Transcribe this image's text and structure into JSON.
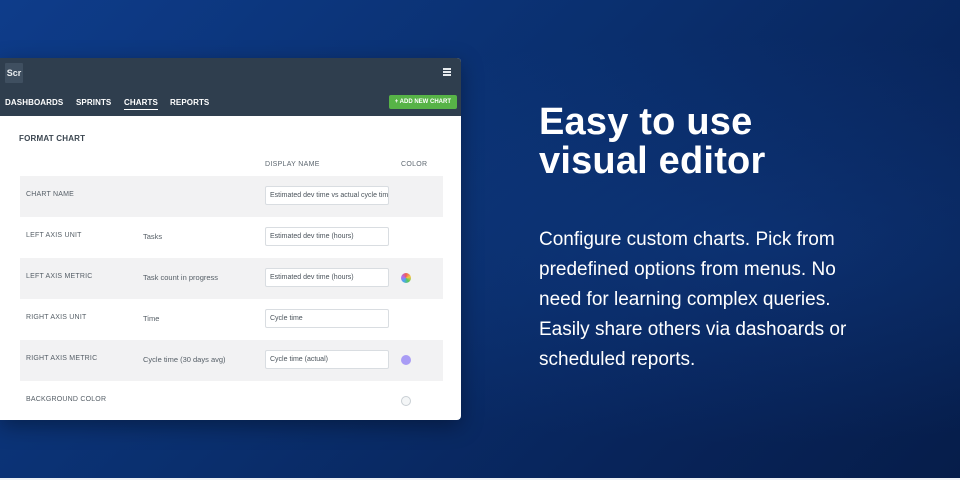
{
  "app": {
    "logo_text": "Scr",
    "nav": [
      "DASHBOARDS",
      "SPRINTS",
      "CHARTS",
      "REPORTS"
    ],
    "active_nav": "CHARTS",
    "add_button": "+ ADD NEW CHART"
  },
  "panel": {
    "title": "FORMAT CHART",
    "col_display_name": "DISPLAY NAME",
    "col_color": "COLOR",
    "rows": [
      {
        "label": "CHART NAME",
        "value": "",
        "field": "Estimated dev time vs actual cycle time",
        "color": ""
      },
      {
        "label": "LEFT AXIS UNIT",
        "value": "Tasks",
        "field": "Estimated dev time (hours)",
        "color": ""
      },
      {
        "label": "LEFT AXIS METRIC",
        "value": "Task count in progress",
        "field": "Estimated dev time (hours)",
        "color": "multicolor"
      },
      {
        "label": "RIGHT AXIS UNIT",
        "value": "Time",
        "field": "Cycle time",
        "color": ""
      },
      {
        "label": "RIGHT AXIS METRIC",
        "value": "Cycle time (30 days avg)",
        "field": "Cycle time (actual)",
        "color": "#a99cf5"
      },
      {
        "label": "BACKGROUND COLOR",
        "value": "",
        "field": "",
        "color": "none"
      }
    ]
  },
  "marketing": {
    "headline_line1": "Easy to use",
    "headline_line2": "visual editor",
    "body_lines": [
      "Configure custom charts. Pick from",
      "predefined options from menus. No",
      "need for learning complex queries.",
      "Easily share others via dashoards or",
      "scheduled reports."
    ]
  },
  "colors": {
    "background": "#0a2f6e",
    "topbar": "#2f3e4e",
    "accent_button": "#57b347"
  }
}
